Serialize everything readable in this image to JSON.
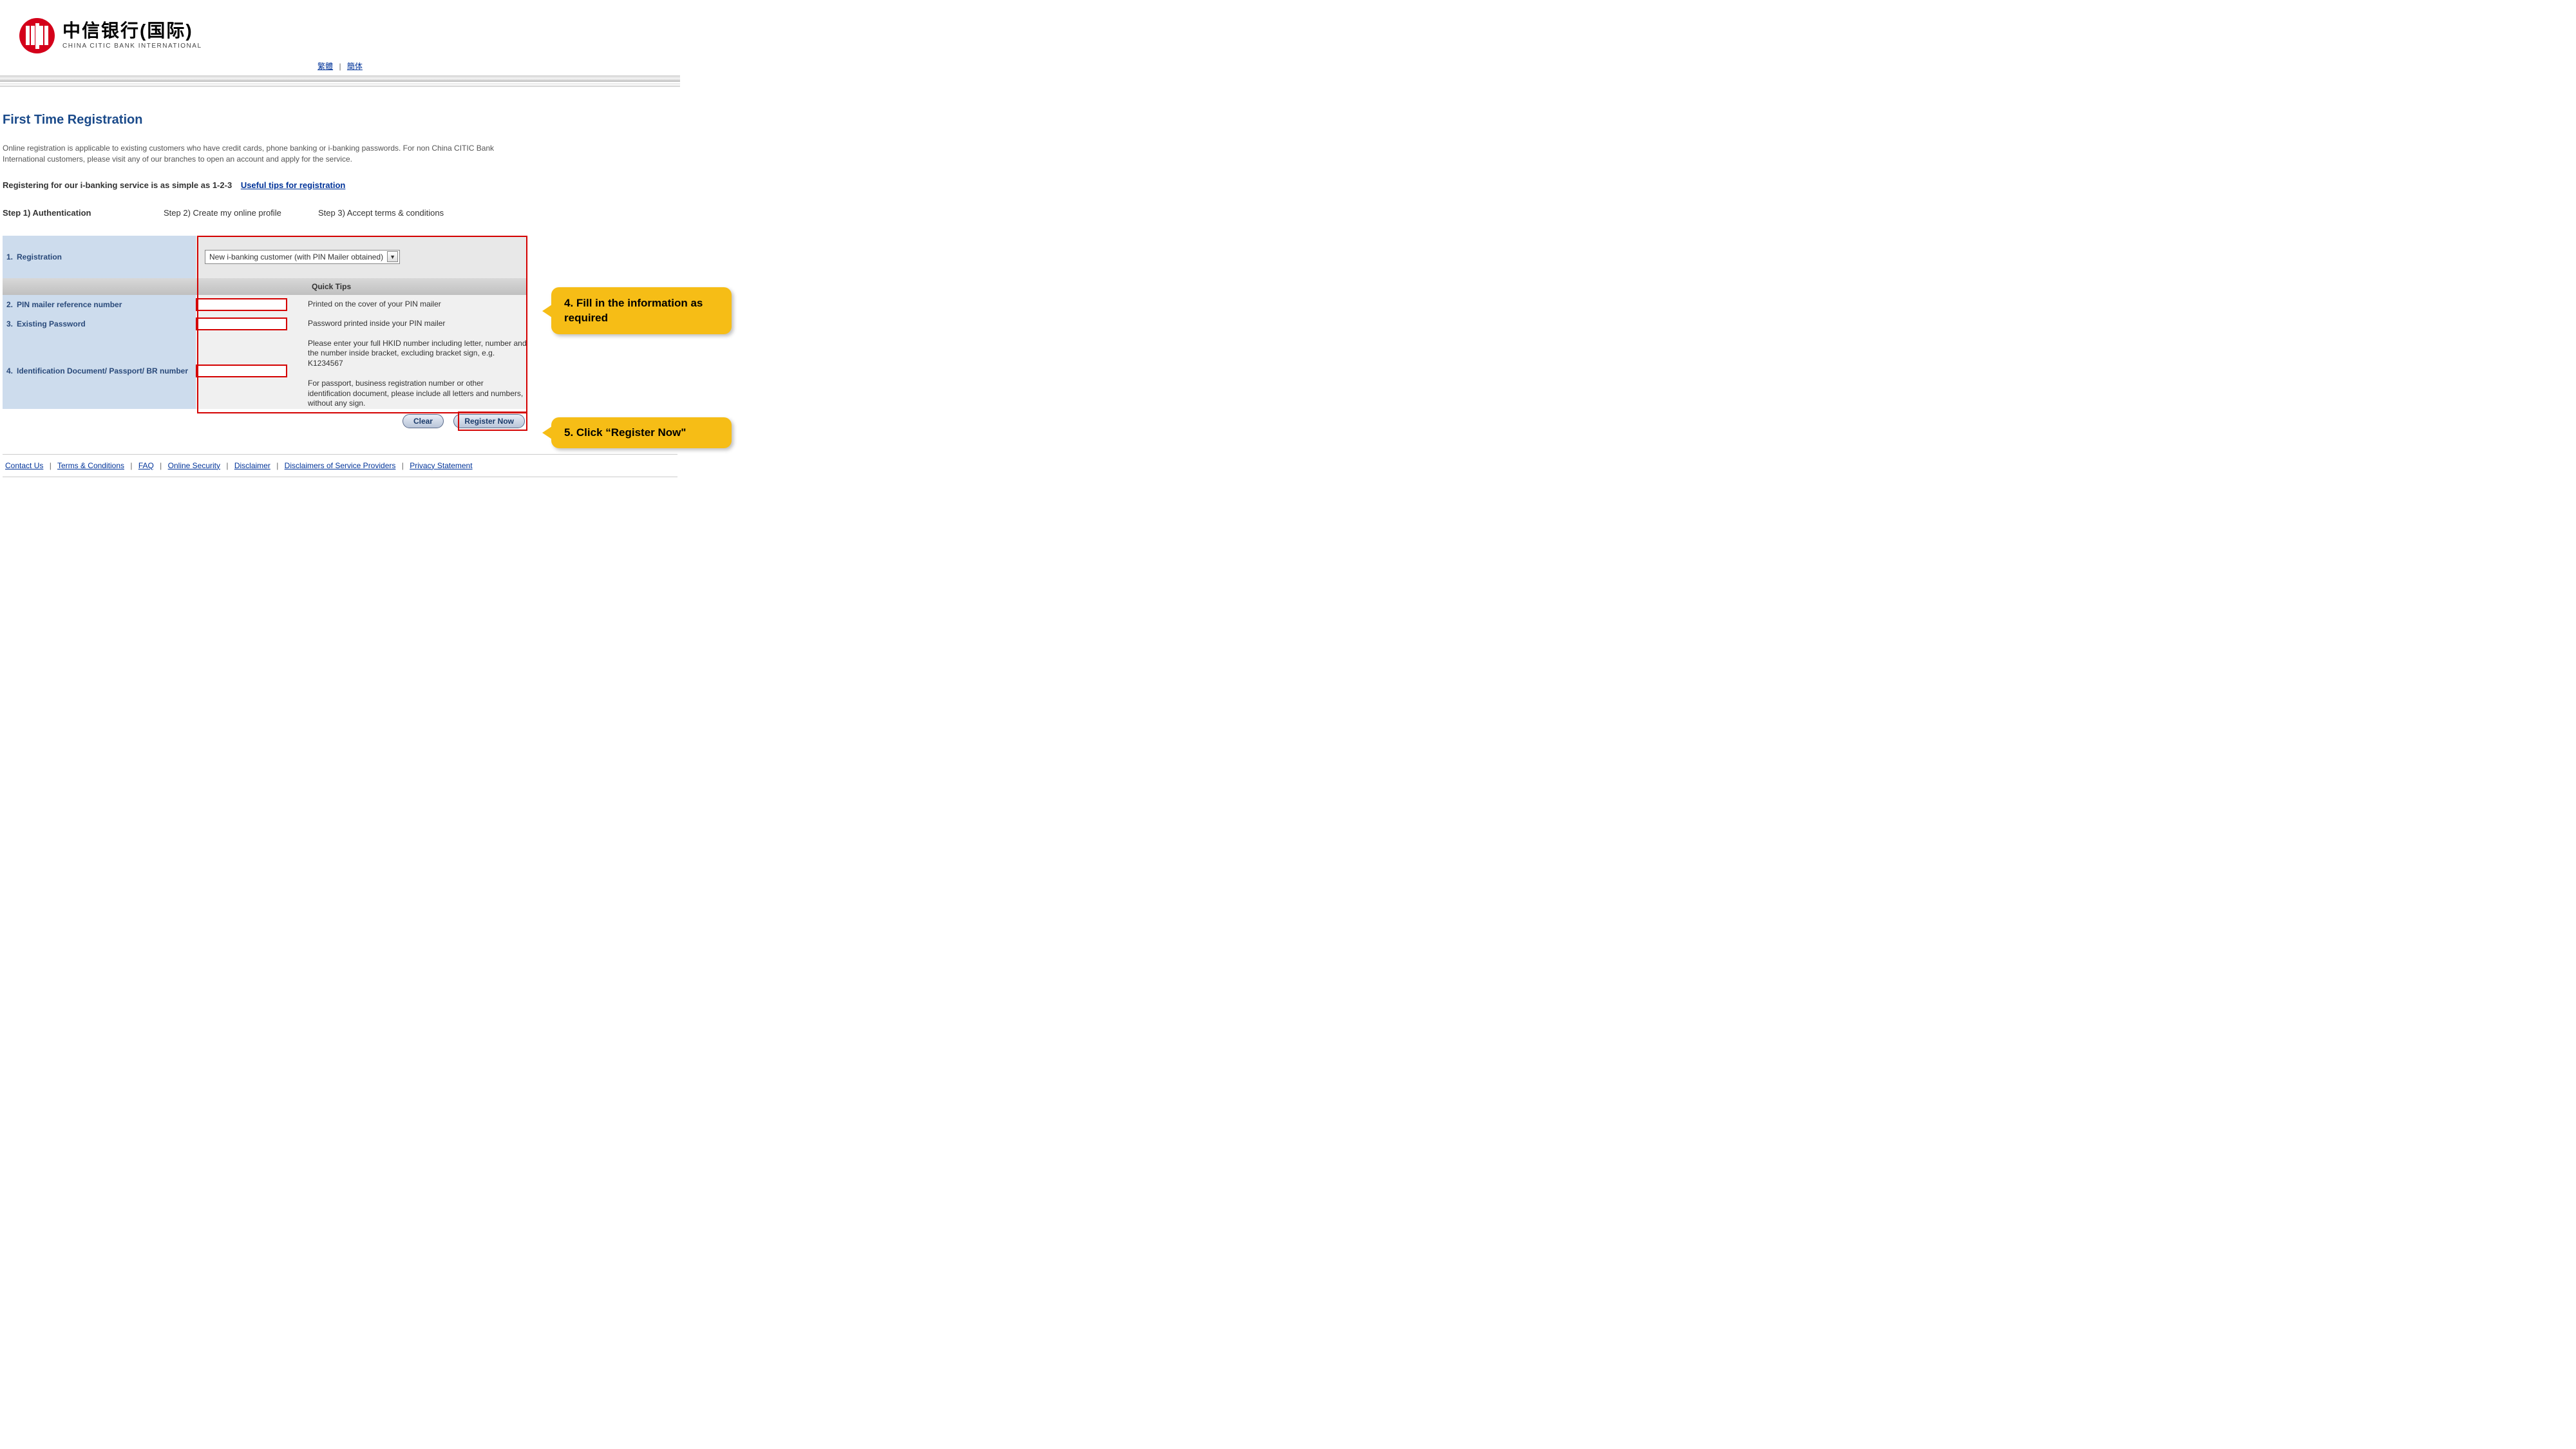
{
  "logo": {
    "cn": "中信银行(国际)",
    "en": "CHINA CITIC BANK INTERNATIONAL"
  },
  "lang": {
    "trad": "繁體",
    "simp": "簡体"
  },
  "page": {
    "title": "First Time Registration",
    "intro": "Online registration is applicable to existing customers who have credit cards, phone banking or i-banking passwords. For non China CITIC Bank International customers, please visit any of our branches to open an account and apply for the service.",
    "reg_text": "Registering for our i-banking service is as simple as 1-2-3",
    "tips_link": "Useful tips for registration"
  },
  "steps": {
    "s1": "Step 1) Authentication",
    "s2": "Step 2) Create my online profile",
    "s3": "Step 3) Accept terms & conditions"
  },
  "form": {
    "row1_num": "1.",
    "row1_label": "Registration",
    "row1_value": "New i-banking customer (with PIN Mailer obtained)",
    "quick_tips": "Quick Tips",
    "row2_num": "2.",
    "row2_label": "PIN mailer reference number",
    "row2_tip": "Printed on the cover of your PIN mailer",
    "row3_num": "3.",
    "row3_label": "Existing Password",
    "row3_tip": "Password printed inside your PIN mailer",
    "row4_num": "4.",
    "row4_label": "Identification Document/ Passport/ BR number",
    "row4_tip_a": "Please enter your full HKID number including letter, number and the number inside bracket, excluding bracket sign, e.g. K1234567",
    "row4_tip_b": "For passport, business registration number or other identification document, please include all letters and numbers, without any sign."
  },
  "buttons": {
    "clear": "Clear",
    "register": "Register Now"
  },
  "callouts": {
    "c4": "4. Fill in the information as required",
    "c5": "5. Click “Register Now\""
  },
  "footer": {
    "l1": "Contact Us",
    "l2": "Terms & Conditions",
    "l3": "FAQ",
    "l4": "Online Security",
    "l5": "Disclaimer",
    "l6": "Disclaimers of Service Providers",
    "l7": "Privacy Statement"
  }
}
